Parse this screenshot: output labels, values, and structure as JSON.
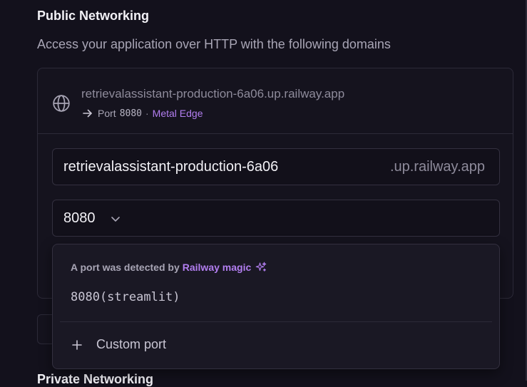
{
  "section": {
    "title": "Public Networking",
    "description": "Access your application over HTTP with the following domains"
  },
  "domain": {
    "url": "retrievalassistant-production-6a06.up.railway.app",
    "port_prefix": "Port",
    "port": "8080",
    "separator": "·",
    "edge": "Metal Edge"
  },
  "subdomain_input": {
    "value": "retrievalassistant-production-6a06",
    "suffix": ".up.railway.app"
  },
  "port_select": {
    "value": "8080"
  },
  "dropdown": {
    "detected_prefix": "A port was detected by",
    "detected_brand": "Railway magic",
    "option": "8080(streamlit)",
    "custom_port_label": "Custom port"
  },
  "behind": {
    "next_section_title": "Private Networking"
  },
  "colors": {
    "background": "#13111c",
    "accent_purple": "#b27ef0",
    "border": "#2c2a38"
  },
  "icons": [
    "globe-icon",
    "arrow-right-icon",
    "chevron-down-icon",
    "sparkle-icon",
    "plus-icon"
  ]
}
